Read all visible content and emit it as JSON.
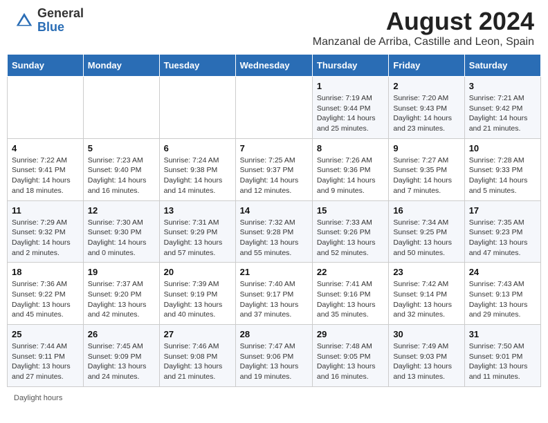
{
  "header": {
    "logo_general": "General",
    "logo_blue": "Blue",
    "month_year": "August 2024",
    "location": "Manzanal de Arriba, Castille and Leon, Spain"
  },
  "weekdays": [
    "Sunday",
    "Monday",
    "Tuesday",
    "Wednesday",
    "Thursday",
    "Friday",
    "Saturday"
  ],
  "weeks": [
    [
      {
        "num": "",
        "info": ""
      },
      {
        "num": "",
        "info": ""
      },
      {
        "num": "",
        "info": ""
      },
      {
        "num": "",
        "info": ""
      },
      {
        "num": "1",
        "info": "Sunrise: 7:19 AM\nSunset: 9:44 PM\nDaylight: 14 hours\nand 25 minutes."
      },
      {
        "num": "2",
        "info": "Sunrise: 7:20 AM\nSunset: 9:43 PM\nDaylight: 14 hours\nand 23 minutes."
      },
      {
        "num": "3",
        "info": "Sunrise: 7:21 AM\nSunset: 9:42 PM\nDaylight: 14 hours\nand 21 minutes."
      }
    ],
    [
      {
        "num": "4",
        "info": "Sunrise: 7:22 AM\nSunset: 9:41 PM\nDaylight: 14 hours\nand 18 minutes."
      },
      {
        "num": "5",
        "info": "Sunrise: 7:23 AM\nSunset: 9:40 PM\nDaylight: 14 hours\nand 16 minutes."
      },
      {
        "num": "6",
        "info": "Sunrise: 7:24 AM\nSunset: 9:38 PM\nDaylight: 14 hours\nand 14 minutes."
      },
      {
        "num": "7",
        "info": "Sunrise: 7:25 AM\nSunset: 9:37 PM\nDaylight: 14 hours\nand 12 minutes."
      },
      {
        "num": "8",
        "info": "Sunrise: 7:26 AM\nSunset: 9:36 PM\nDaylight: 14 hours\nand 9 minutes."
      },
      {
        "num": "9",
        "info": "Sunrise: 7:27 AM\nSunset: 9:35 PM\nDaylight: 14 hours\nand 7 minutes."
      },
      {
        "num": "10",
        "info": "Sunrise: 7:28 AM\nSunset: 9:33 PM\nDaylight: 14 hours\nand 5 minutes."
      }
    ],
    [
      {
        "num": "11",
        "info": "Sunrise: 7:29 AM\nSunset: 9:32 PM\nDaylight: 14 hours\nand 2 minutes."
      },
      {
        "num": "12",
        "info": "Sunrise: 7:30 AM\nSunset: 9:30 PM\nDaylight: 14 hours\nand 0 minutes."
      },
      {
        "num": "13",
        "info": "Sunrise: 7:31 AM\nSunset: 9:29 PM\nDaylight: 13 hours\nand 57 minutes."
      },
      {
        "num": "14",
        "info": "Sunrise: 7:32 AM\nSunset: 9:28 PM\nDaylight: 13 hours\nand 55 minutes."
      },
      {
        "num": "15",
        "info": "Sunrise: 7:33 AM\nSunset: 9:26 PM\nDaylight: 13 hours\nand 52 minutes."
      },
      {
        "num": "16",
        "info": "Sunrise: 7:34 AM\nSunset: 9:25 PM\nDaylight: 13 hours\nand 50 minutes."
      },
      {
        "num": "17",
        "info": "Sunrise: 7:35 AM\nSunset: 9:23 PM\nDaylight: 13 hours\nand 47 minutes."
      }
    ],
    [
      {
        "num": "18",
        "info": "Sunrise: 7:36 AM\nSunset: 9:22 PM\nDaylight: 13 hours\nand 45 minutes."
      },
      {
        "num": "19",
        "info": "Sunrise: 7:37 AM\nSunset: 9:20 PM\nDaylight: 13 hours\nand 42 minutes."
      },
      {
        "num": "20",
        "info": "Sunrise: 7:39 AM\nSunset: 9:19 PM\nDaylight: 13 hours\nand 40 minutes."
      },
      {
        "num": "21",
        "info": "Sunrise: 7:40 AM\nSunset: 9:17 PM\nDaylight: 13 hours\nand 37 minutes."
      },
      {
        "num": "22",
        "info": "Sunrise: 7:41 AM\nSunset: 9:16 PM\nDaylight: 13 hours\nand 35 minutes."
      },
      {
        "num": "23",
        "info": "Sunrise: 7:42 AM\nSunset: 9:14 PM\nDaylight: 13 hours\nand 32 minutes."
      },
      {
        "num": "24",
        "info": "Sunrise: 7:43 AM\nSunset: 9:13 PM\nDaylight: 13 hours\nand 29 minutes."
      }
    ],
    [
      {
        "num": "25",
        "info": "Sunrise: 7:44 AM\nSunset: 9:11 PM\nDaylight: 13 hours\nand 27 minutes."
      },
      {
        "num": "26",
        "info": "Sunrise: 7:45 AM\nSunset: 9:09 PM\nDaylight: 13 hours\nand 24 minutes."
      },
      {
        "num": "27",
        "info": "Sunrise: 7:46 AM\nSunset: 9:08 PM\nDaylight: 13 hours\nand 21 minutes."
      },
      {
        "num": "28",
        "info": "Sunrise: 7:47 AM\nSunset: 9:06 PM\nDaylight: 13 hours\nand 19 minutes."
      },
      {
        "num": "29",
        "info": "Sunrise: 7:48 AM\nSunset: 9:05 PM\nDaylight: 13 hours\nand 16 minutes."
      },
      {
        "num": "30",
        "info": "Sunrise: 7:49 AM\nSunset: 9:03 PM\nDaylight: 13 hours\nand 13 minutes."
      },
      {
        "num": "31",
        "info": "Sunrise: 7:50 AM\nSunset: 9:01 PM\nDaylight: 13 hours\nand 11 minutes."
      }
    ]
  ],
  "footer": {
    "daylight_label": "Daylight hours"
  }
}
